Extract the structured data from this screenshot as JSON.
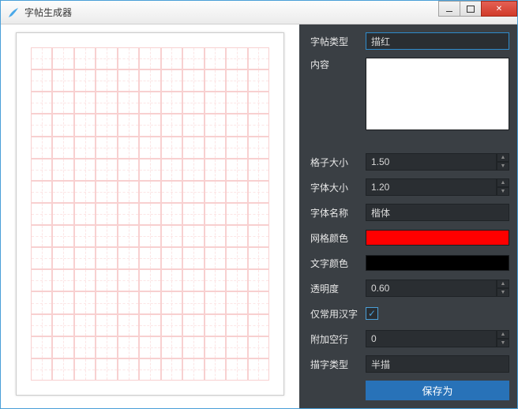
{
  "window": {
    "title": "字帖生成器"
  },
  "settings": {
    "type_label": "字帖类型",
    "type_value": "描红",
    "content_label": "内容",
    "content_value": "",
    "grid_size_label": "格子大小",
    "grid_size_value": "1.50",
    "font_size_label": "字体大小",
    "font_size_value": "1.20",
    "font_name_label": "字体名称",
    "font_name_value": "楷体",
    "grid_color_label": "网格颜色",
    "grid_color_value": "#ff0000",
    "text_color_label": "文字颜色",
    "text_color_value": "#000000",
    "opacity_label": "透明度",
    "opacity_value": "0.60",
    "common_only_label": "仅常用汉字",
    "common_only_checked": true,
    "blank_lines_label": "附加空行",
    "blank_lines_value": "0",
    "trace_type_label": "描字类型",
    "trace_type_value": "半描",
    "save_button": "保存为"
  }
}
